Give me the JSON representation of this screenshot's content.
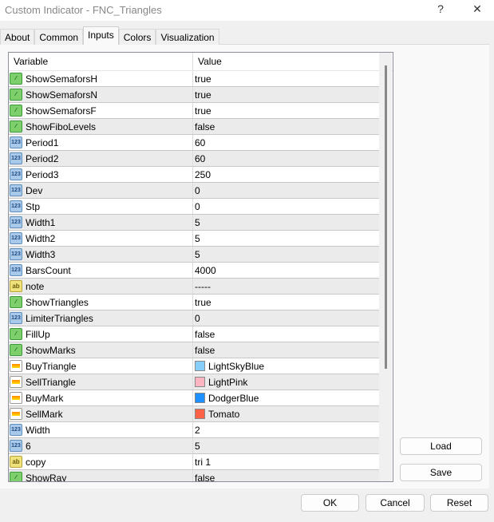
{
  "window": {
    "title": "Custom Indicator - FNC_Triangles",
    "help": "?",
    "close": "✕"
  },
  "tabs": [
    {
      "label": "About"
    },
    {
      "label": "Common"
    },
    {
      "label": "Inputs",
      "active": true
    },
    {
      "label": "Colors"
    },
    {
      "label": "Visualization"
    }
  ],
  "table": {
    "headers": {
      "variable": "Variable",
      "value": "Value"
    },
    "rows": [
      {
        "type": "bool",
        "name": "ShowSemaforsH",
        "value": "true"
      },
      {
        "type": "bool",
        "name": "ShowSemaforsN",
        "value": "true"
      },
      {
        "type": "bool",
        "name": "ShowSemaforsF",
        "value": "true"
      },
      {
        "type": "bool",
        "name": "ShowFiboLevels",
        "value": "false"
      },
      {
        "type": "num",
        "name": "Period1",
        "value": "60"
      },
      {
        "type": "num",
        "name": "Period2",
        "value": "60"
      },
      {
        "type": "num",
        "name": "Period3",
        "value": "250"
      },
      {
        "type": "num",
        "name": "Dev",
        "value": "0"
      },
      {
        "type": "num",
        "name": "Stp",
        "value": "0"
      },
      {
        "type": "num",
        "name": "Width1",
        "value": "5"
      },
      {
        "type": "num",
        "name": "Width2",
        "value": "5"
      },
      {
        "type": "num",
        "name": "Width3",
        "value": "5"
      },
      {
        "type": "num",
        "name": "BarsCount",
        "value": "4000"
      },
      {
        "type": "str",
        "name": "note",
        "value": "-----"
      },
      {
        "type": "bool",
        "name": "ShowTriangles",
        "value": "true"
      },
      {
        "type": "num",
        "name": "LimiterTriangles",
        "value": "0"
      },
      {
        "type": "bool",
        "name": "FillUp",
        "value": "false"
      },
      {
        "type": "bool",
        "name": "ShowMarks",
        "value": "false"
      },
      {
        "type": "col",
        "name": "BuyTriangle",
        "value": "LightSkyBlue",
        "color": "#87cefa"
      },
      {
        "type": "col",
        "name": "SellTriangle",
        "value": "LightPink",
        "color": "#ffb6c1"
      },
      {
        "type": "col",
        "name": "BuyMark",
        "value": "DodgerBlue",
        "color": "#1e90ff"
      },
      {
        "type": "col",
        "name": "SellMark",
        "value": "Tomato",
        "color": "#ff6347"
      },
      {
        "type": "num",
        "name": "Width",
        "value": "2"
      },
      {
        "type": "num",
        "name": "6",
        "value": "5"
      },
      {
        "type": "str",
        "name": "copy",
        "value": "tri 1"
      },
      {
        "type": "bool",
        "name": "ShowRay",
        "value": "false"
      }
    ]
  },
  "buttons": {
    "load": "Load",
    "save": "Save",
    "ok": "OK",
    "cancel": "Cancel",
    "reset": "Reset"
  },
  "icons": {
    "bool": "boolean-icon",
    "num": "number-icon",
    "str": "string-icon",
    "col": "color-icon"
  }
}
